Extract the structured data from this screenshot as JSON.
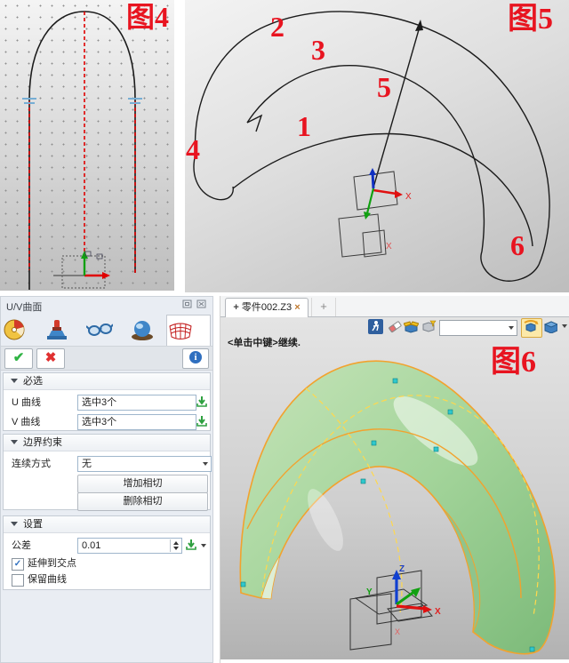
{
  "figures": {
    "fig4": {
      "label": "图4"
    },
    "fig5": {
      "label": "图5",
      "curve_labels": [
        "1",
        "2",
        "3",
        "4",
        "5",
        "6"
      ],
      "axis_x_label": "X"
    },
    "fig6": {
      "label": "图6"
    }
  },
  "panel": {
    "title": "U/V曲面",
    "ok_glyph": "✔",
    "cancel_glyph": "✖",
    "info_glyph": "i",
    "sections": {
      "required": {
        "header": "必选",
        "rows": [
          {
            "label": "U 曲线",
            "value": "选中3个"
          },
          {
            "label": "V 曲线",
            "value": "选中3个"
          }
        ]
      },
      "boundary": {
        "header": "边界约束",
        "continuity_label": "连续方式",
        "continuity_value": "无",
        "add_tangent_label": "增加相切",
        "remove_tangent_label": "删除相切"
      },
      "settings": {
        "header": "设置",
        "tolerance_label": "公差",
        "tolerance_value": "0.01",
        "checkboxes": [
          {
            "label": "延伸到交点",
            "checked": true
          },
          {
            "label": "保留曲线",
            "checked": false
          }
        ]
      }
    }
  },
  "workspace": {
    "tab_add_glyph": "+",
    "tab_label": "零件002.Z3",
    "tab_close_glyph": "×",
    "new_tab_glyph": "+",
    "prompt": "<单击中键>继续.",
    "filter_combo_value": "",
    "triad": {
      "x": "X",
      "y": "Y",
      "z": "Z"
    }
  }
}
